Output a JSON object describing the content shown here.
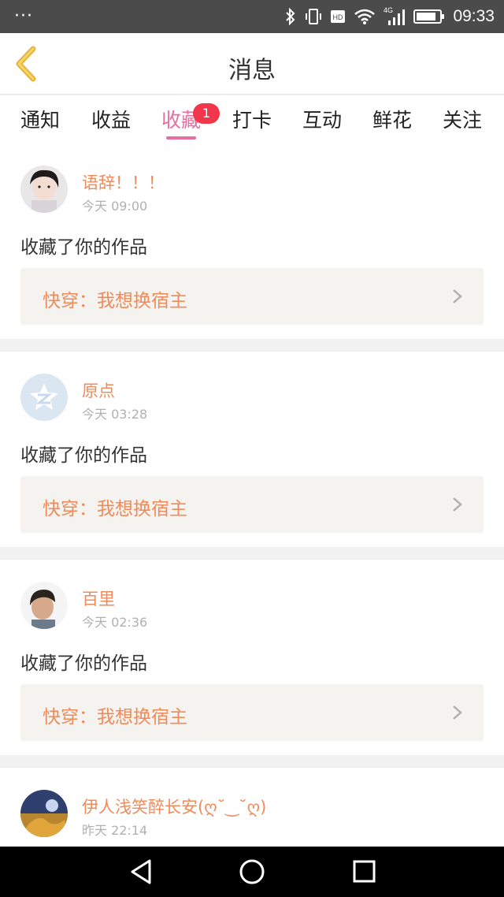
{
  "status": {
    "time": "09:33",
    "network": "4G",
    "hd": "HD"
  },
  "header": {
    "title": "消息",
    "back_icon": "back-chevron-icon"
  },
  "tabs": [
    {
      "label": "通知"
    },
    {
      "label": "收益"
    },
    {
      "label": "收藏",
      "active": true,
      "badge": "1"
    },
    {
      "label": "打卡"
    },
    {
      "label": "互动"
    },
    {
      "label": "鲜花"
    },
    {
      "label": "关注"
    }
  ],
  "notifications": [
    {
      "user": "语辞！！！",
      "time": "今天 09:00",
      "action": "收藏了你的作品",
      "work": "快穿：我想换宿主"
    },
    {
      "user": "原点",
      "time": "今天 03:28",
      "action": "收藏了你的作品",
      "work": "快穿：我想换宿主"
    },
    {
      "user": "百里",
      "time": "今天 02:36",
      "action": "收藏了你的作品",
      "work": "快穿：我想换宿主"
    },
    {
      "user": "伊人浅笑醉长安(ღ˘‿˘ღ)",
      "time": "昨天 22:14",
      "action": "",
      "work": ""
    }
  ],
  "colors": {
    "accent": "#e76fa0",
    "name": "#ef8b5a",
    "badge": "#f2364b"
  }
}
